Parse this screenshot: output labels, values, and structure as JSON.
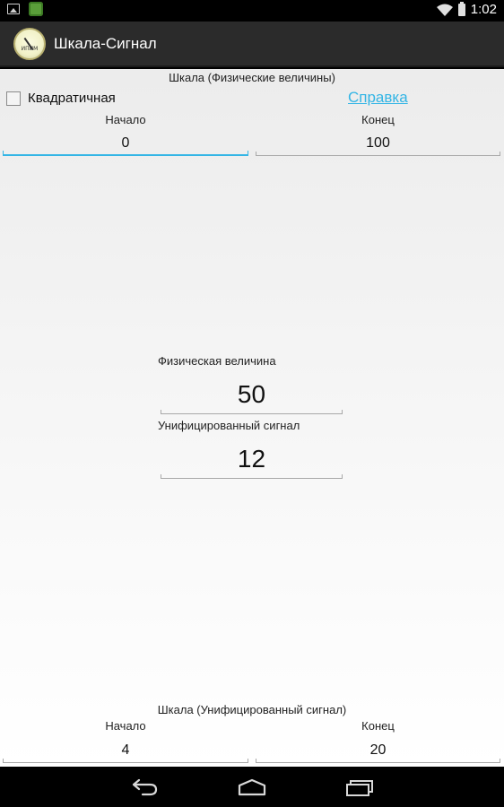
{
  "status_bar": {
    "time": "1:02"
  },
  "action_bar": {
    "title": "Шкала-Сигнал",
    "logo_text": "ИПИМ"
  },
  "physical_scale": {
    "title": "Шкала (Физические величины)",
    "quadratic_label": "Квадратичная",
    "quadratic_checked": false,
    "help_link": "Справка",
    "start_label": "Начало",
    "start_value": "0",
    "end_label": "Конец",
    "end_value": "100"
  },
  "conversion": {
    "physical_label": "Физическая величина",
    "physical_value": "50",
    "signal_label": "Унифицированный сигнал",
    "signal_value": "12"
  },
  "signal_scale": {
    "title": "Шкала (Унифицированный сигнал)",
    "start_label": "Начало",
    "start_value": "4",
    "end_label": "Конец",
    "end_value": "20"
  },
  "colors": {
    "accent": "#33b5e5",
    "action_bar": "#2b2b2b"
  }
}
